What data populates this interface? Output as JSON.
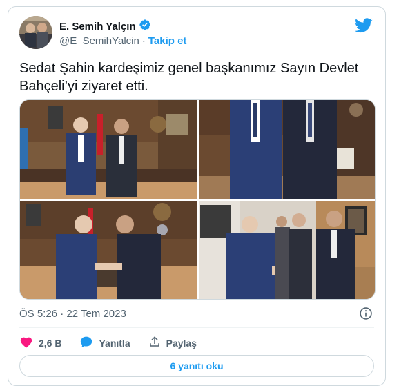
{
  "author": {
    "name": "E. Semih Yalçın",
    "handle": "@E_SemihYalcin",
    "separator": "·",
    "follow_label": "Takip et"
  },
  "tweet": {
    "text_line1": "Sedat Şahin kardeşimiz genel başkanımız Sayın Devlet",
    "text_line2": "Bahçeli’yi ziyaret etti.",
    "timestamp": "ÖS 5:26 · 22 Tem 2023"
  },
  "actions": {
    "like_count": "2,6 B",
    "reply_label": "Yanıtla",
    "share_label": "Paylaş"
  },
  "replies_button": "6 yanıtı oku",
  "colors": {
    "accent": "#1d9bf0",
    "like": "#f91880",
    "verified": "#1d9bf0"
  },
  "icons": [
    "twitter-bird-icon",
    "verified-badge-icon",
    "heart-icon",
    "reply-bubble-icon",
    "share-icon",
    "info-icon"
  ]
}
